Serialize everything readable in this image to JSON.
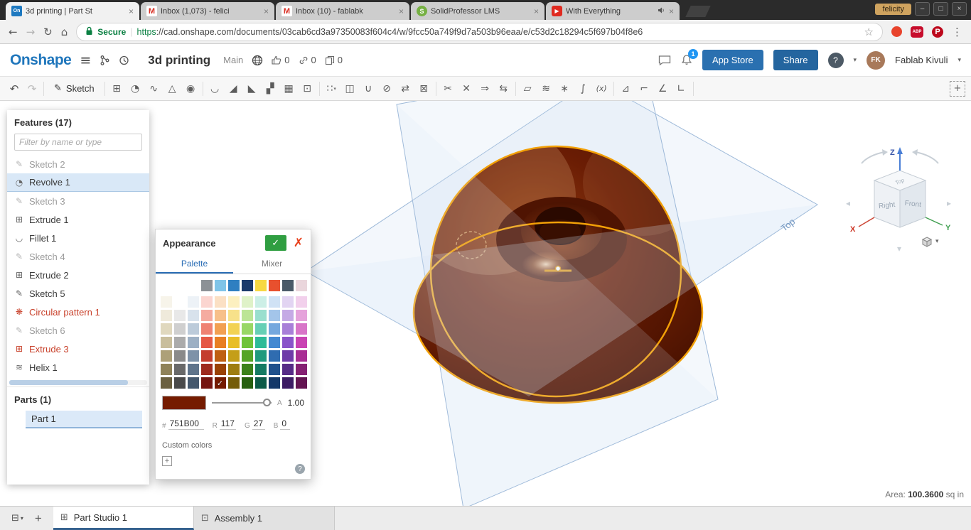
{
  "glyphs": {
    "close": "×",
    "caret": "▾",
    "hamburger": "≡",
    "star": "☆",
    "menu": "⋮",
    "undo": "↶",
    "redo": "↷",
    "pencil": "✎",
    "tab_manager": "⊟",
    "plus": "+",
    "part_studio": "⊞",
    "assembly": "⊡"
  },
  "browser": {
    "window_user": "felicity",
    "window_controls": {
      "minimize": "–",
      "maximize": "□",
      "close": "×"
    },
    "tabs": [
      {
        "title": "3d printing | Part St",
        "favicon": "onshape",
        "favicon_text": "On",
        "active": true
      },
      {
        "title": "Inbox (1,073) - felici",
        "favicon": "gmail",
        "favicon_text": "M"
      },
      {
        "title": "Inbox (10) - fablabk",
        "favicon": "gmail",
        "favicon_text": "M"
      },
      {
        "title": "SolidProfessor LMS",
        "favicon": "solidprofessor",
        "favicon_text": "S"
      },
      {
        "title": "With Everything",
        "favicon": "youtube",
        "favicon_text": "▶",
        "audio": true
      }
    ],
    "nav": {
      "back": "←",
      "forward": "→",
      "reload": "↻",
      "home": "⌂"
    },
    "security_label": "Secure",
    "url_scheme": "https",
    "url_rest": "://cad.onshape.com/documents/03cab6cd3a97350083f604c4/w/9fcc50a749f9d7a503b96eaa/e/c53d2c18294c5f697b04f8e6",
    "extensions": {
      "adblock": "ABP",
      "pinterest": "P"
    }
  },
  "header": {
    "logo": "Onshape",
    "doc_title": "3d printing",
    "workspace_label": "Main",
    "like_count": "0",
    "link_count": "0",
    "copy_count": "0",
    "notification_badge": "1",
    "app_store_button": "App Store",
    "share_button": "Share",
    "help_label": "?",
    "user_name": "Fablab Kivuli"
  },
  "toolbar": {
    "sketch_label": "Sketch",
    "icons": [
      {
        "name": "extrude",
        "glyph": "⊞"
      },
      {
        "name": "revolve",
        "glyph": "◔"
      },
      {
        "name": "sweep",
        "glyph": "∿"
      },
      {
        "name": "loft",
        "glyph": "△"
      },
      {
        "name": "thicken",
        "glyph": "◉"
      },
      {
        "sep": true
      },
      {
        "name": "fillet",
        "glyph": "◡"
      },
      {
        "name": "chamfer",
        "glyph": "◢"
      },
      {
        "name": "draft",
        "glyph": "◣"
      },
      {
        "name": "rib",
        "glyph": "▞"
      },
      {
        "name": "shell",
        "glyph": "▦"
      },
      {
        "name": "hole",
        "glyph": "⊡"
      },
      {
        "sep": true
      },
      {
        "name": "linear-pattern",
        "glyph": "∷",
        "caret": true
      },
      {
        "name": "mirror",
        "glyph": "◫"
      },
      {
        "name": "boolean",
        "glyph": "∪"
      },
      {
        "name": "split",
        "glyph": "⊘"
      },
      {
        "name": "transform",
        "glyph": "⇄"
      },
      {
        "name": "delete-part",
        "glyph": "⊠"
      },
      {
        "sep": true
      },
      {
        "name": "modify-fillet",
        "glyph": "✂"
      },
      {
        "name": "delete-face",
        "glyph": "✕"
      },
      {
        "name": "move-face",
        "glyph": "⇒"
      },
      {
        "name": "replace-face",
        "glyph": "⇆"
      },
      {
        "sep": true
      },
      {
        "name": "plane",
        "glyph": "▱"
      },
      {
        "name": "helix",
        "glyph": "≋"
      },
      {
        "name": "point",
        "glyph": "∗"
      },
      {
        "name": "curve",
        "glyph": "∫"
      },
      {
        "name": "variable",
        "glyph": "(x)"
      },
      {
        "sep": true
      },
      {
        "name": "sheet-metal",
        "glyph": "⊿"
      },
      {
        "name": "flange",
        "glyph": "⌐"
      },
      {
        "name": "hem",
        "glyph": "∠"
      },
      {
        "name": "corner",
        "glyph": "∟"
      },
      {
        "sep": true
      },
      {
        "name": "center-of-mass",
        "glyph": "+",
        "last": true
      }
    ]
  },
  "features_panel": {
    "title": "Features (17)",
    "filter_placeholder": "Filter by name or type",
    "items": [
      {
        "label": "Sketch 2",
        "icon": "sketch",
        "glyph": "✎",
        "state": "muted"
      },
      {
        "label": "Revolve 1",
        "icon": "revolve",
        "glyph": "◔",
        "state": "selected"
      },
      {
        "label": "Sketch 3",
        "icon": "sketch",
        "glyph": "✎",
        "state": "muted"
      },
      {
        "label": "Extrude 1",
        "icon": "extrude",
        "glyph": "⊞",
        "state": "normal"
      },
      {
        "label": "Fillet 1",
        "icon": "fillet",
        "glyph": "◡",
        "state": "normal"
      },
      {
        "label": "Sketch 4",
        "icon": "sketch",
        "glyph": "✎",
        "state": "muted"
      },
      {
        "label": "Extrude 2",
        "icon": "extrude",
        "glyph": "⊞",
        "state": "normal"
      },
      {
        "label": "Sketch 5",
        "icon": "sketch",
        "glyph": "✎",
        "state": "normal"
      },
      {
        "label": "Circular pattern 1",
        "icon": "circular-pattern",
        "glyph": "❋",
        "state": "error"
      },
      {
        "label": "Sketch 6",
        "icon": "sketch",
        "glyph": "✎",
        "state": "muted"
      },
      {
        "label": "Extrude 3",
        "icon": "extrude",
        "glyph": "⊞",
        "state": "error"
      },
      {
        "label": "Helix 1",
        "icon": "helix",
        "glyph": "≋",
        "state": "normal"
      }
    ],
    "parts_title": "Parts (1)",
    "parts": [
      {
        "label": "Part 1"
      }
    ]
  },
  "appearance": {
    "title": "Appearance",
    "confirm_glyph": "✓",
    "cancel_glyph": "✗",
    "tabs": {
      "palette": "Palette",
      "mixer": "Mixer"
    },
    "quick_row": [
      "#8C9196",
      "#7FC4E8",
      "#2F7FC1",
      "#1B3A6B",
      "#F7D842",
      "#E8502E",
      "#4A5A68",
      "#EAD6DC"
    ],
    "grid": [
      [
        "#F7F4EA",
        "#FFFFFF",
        "#EDF2F7",
        "#FBD5D0",
        "#FBE0C4",
        "#FCF0C0",
        "#DFF2C8",
        "#CCEFE6",
        "#D0E2F5",
        "#E2D4F2",
        "#F2D0EC"
      ],
      [
        "#EFEADB",
        "#E8E8E8",
        "#D8E2EC",
        "#F5ABA0",
        "#F7C08A",
        "#F7E18A",
        "#BCE596",
        "#99DFCE",
        "#A3C5EA",
        "#C5AAE5",
        "#E5A3DB"
      ],
      [
        "#E0D8BE",
        "#CFCFCF",
        "#BCCBDA",
        "#EF8172",
        "#F2A052",
        "#F2D254",
        "#98D765",
        "#66CFB5",
        "#75A8DE",
        "#A87FD8",
        "#D875C8"
      ],
      [
        "#C9BE9C",
        "#ABABAB",
        "#9DB0C4",
        "#E55845",
        "#E87F23",
        "#E8BE26",
        "#6FC338",
        "#2EBB98",
        "#4489D1",
        "#8A54C9",
        "#C943B3"
      ],
      [
        "#ADA078",
        "#8A8A8A",
        "#7E92A8",
        "#C43D2E",
        "#BF5F12",
        "#C49E18",
        "#55A426",
        "#1F9A7D",
        "#2F6CB0",
        "#6F3BA8",
        "#A82E94"
      ],
      [
        "#8F8259",
        "#696969",
        "#5F748B",
        "#9E2A1E",
        "#9A4206",
        "#9E7D10",
        "#3C821B",
        "#147A62",
        "#1F508C",
        "#562B86",
        "#862173"
      ],
      [
        "#6B6040",
        "#4A4A4A",
        "#45586D",
        "#751510",
        "#751B00",
        "#755C08",
        "#276010",
        "#0B5A48",
        "#143868",
        "#3D1C64",
        "#641552"
      ]
    ],
    "checked": {
      "row": 6,
      "col": 4
    },
    "preview_color": "#751B00",
    "alpha_label": "A",
    "alpha_value": "1.00",
    "hex_label": "#",
    "hex_value": "751B00",
    "r_label": "R",
    "r_value": "117",
    "g_label": "G",
    "g_value": "27",
    "b_label": "B",
    "b_value": "0",
    "custom_colors_label": "Custom colors",
    "add_custom_glyph": "+",
    "help_glyph": "?"
  },
  "viewport": {
    "top_plane_label": "Top",
    "cube": {
      "top": "Top",
      "left": "Right",
      "front": "Front",
      "x": "X",
      "y": "Y",
      "z": "Z"
    },
    "area_label": "Area:",
    "area_value": "100.3600",
    "area_unit": "sq in",
    "model_color": "#751B00",
    "edge_highlight": "#F2A007"
  },
  "bottom_bar": {
    "tabs": [
      {
        "label": "Part Studio 1",
        "active": true
      },
      {
        "label": "Assembly 1"
      }
    ]
  }
}
